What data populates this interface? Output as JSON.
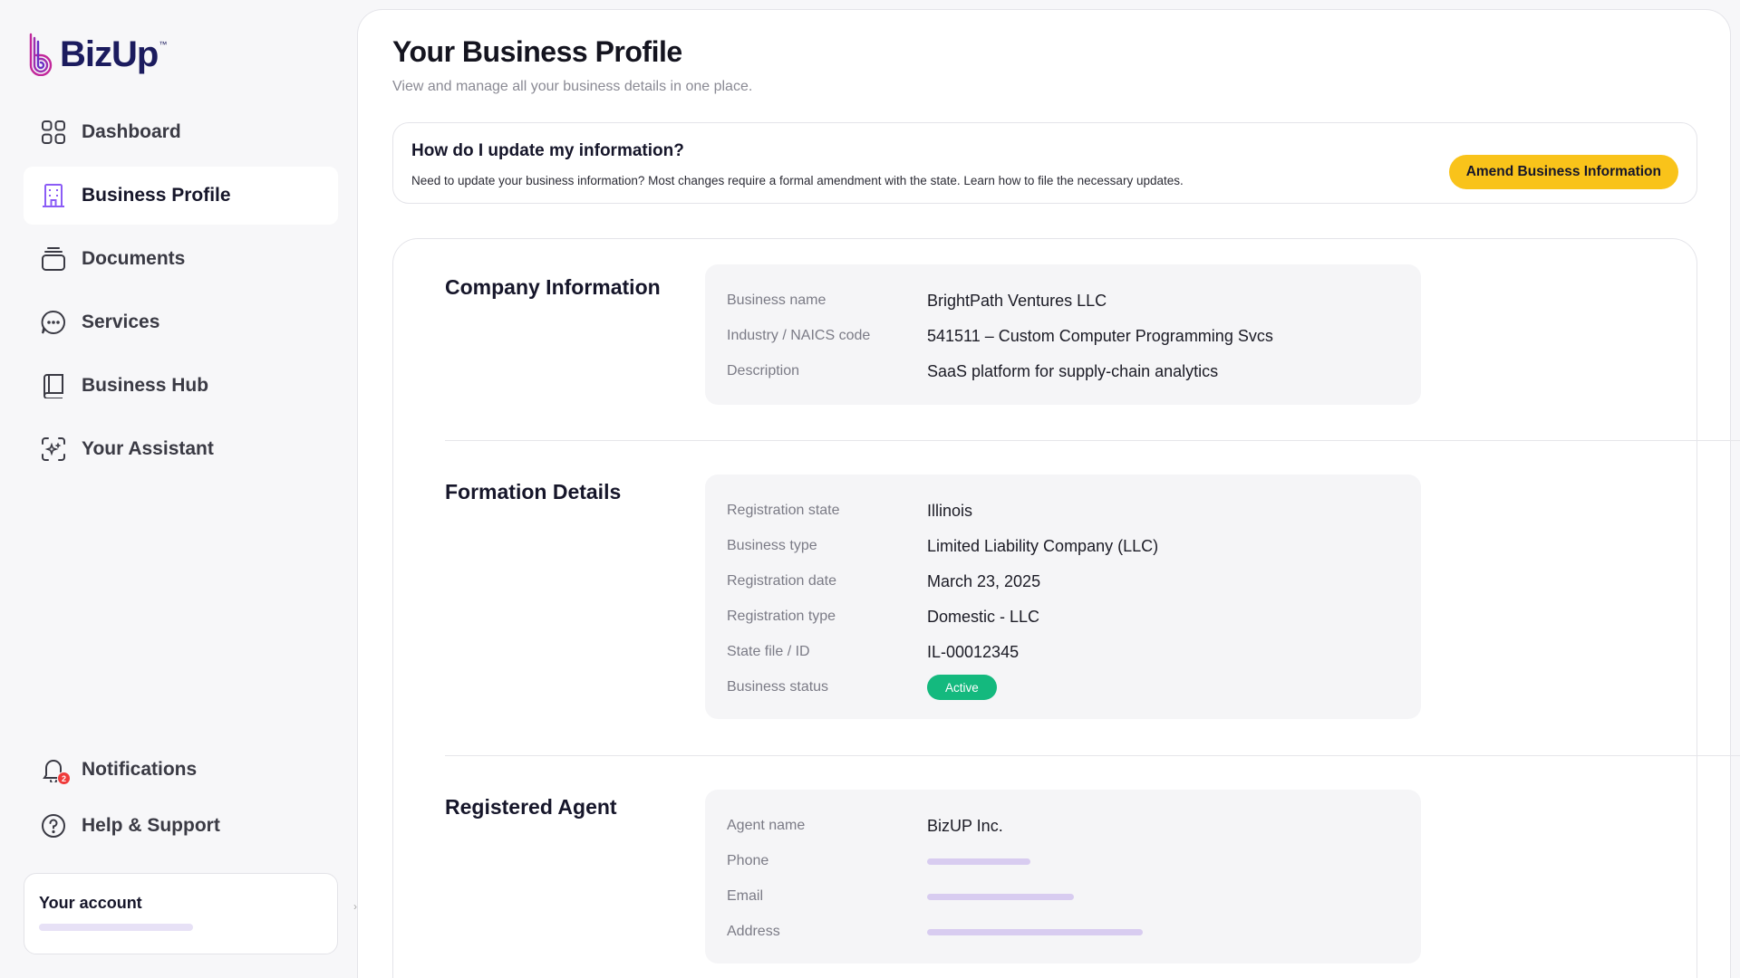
{
  "brand": {
    "name": "BizUp",
    "tm": "™"
  },
  "nav": {
    "items": [
      {
        "label": "Dashboard",
        "icon": "grid-icon"
      },
      {
        "label": "Business Profile",
        "icon": "building-icon",
        "active": true
      },
      {
        "label": "Documents",
        "icon": "stack-icon"
      },
      {
        "label": "Services",
        "icon": "chat-dots-icon"
      },
      {
        "label": "Business Hub",
        "icon": "book-icon"
      },
      {
        "label": "Your Assistant",
        "icon": "sparkle-scan-icon"
      }
    ],
    "bottom": [
      {
        "label": "Notifications",
        "icon": "bell-icon",
        "badge": "2"
      },
      {
        "label": "Help & Support",
        "icon": "question-icon"
      }
    ]
  },
  "account": {
    "title": "Your account"
  },
  "page": {
    "title": "Your Business Profile",
    "subtitle": "View and manage all your business details in one place."
  },
  "banner": {
    "title": "How do I update my information?",
    "text": "Need to update your business information? Most changes require a formal amendment with the state. Learn how to file the necessary updates.",
    "button": "Amend Business Information"
  },
  "company": {
    "title": "Company Information",
    "rows": [
      {
        "label": "Business name",
        "value": "BrightPath Ventures LLC"
      },
      {
        "label": "Industry / NAICS code",
        "value": "541511 – Custom Computer Programming Svcs"
      },
      {
        "label": "Description",
        "value": "SaaS platform for supply-chain analytics"
      }
    ]
  },
  "formation": {
    "title": "Formation Details",
    "rows": [
      {
        "label": "Registration state",
        "value": "Illinois"
      },
      {
        "label": "Business type",
        "value": "Limited Liability Company (LLC)"
      },
      {
        "label": "Registration date",
        "value": "March 23, 2025"
      },
      {
        "label": "Registration type",
        "value": "Domestic - LLC"
      },
      {
        "label": "State file / ID",
        "value": "IL-00012345"
      },
      {
        "label": "Business status",
        "value": "Active"
      }
    ]
  },
  "agent": {
    "title": "Registered Agent",
    "rows": [
      {
        "label": "Agent name",
        "value": "BizUP Inc."
      },
      {
        "label": "Phone"
      },
      {
        "label": "Email"
      },
      {
        "label": "Address"
      }
    ]
  },
  "colors": {
    "accent": "#f9c31a",
    "status_active": "#14b97e",
    "brand_navy": "#1b1b5e",
    "brand_magenta": "#c2279b",
    "icon_purple": "#8b5cf6",
    "badge_red": "#ef3b3b",
    "placeholder": "#d8ccf0"
  }
}
